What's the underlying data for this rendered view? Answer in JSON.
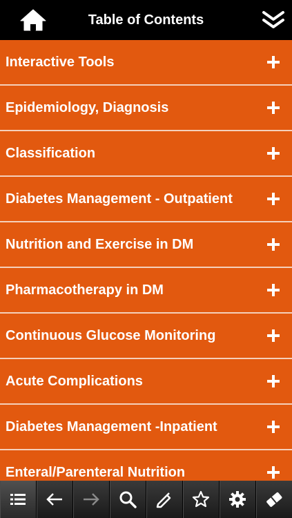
{
  "header": {
    "title": "Table of Contents"
  },
  "colors": {
    "row_background": "#e2590f",
    "row_divider": "#f5d0bb",
    "header_background": "#000000",
    "toolbar_background": "#2a2a2a"
  },
  "toc": {
    "items": [
      {
        "label": "Interactive Tools"
      },
      {
        "label": "Epidemiology, Diagnosis"
      },
      {
        "label": "Classification"
      },
      {
        "label": "Diabetes Management - Outpatient"
      },
      {
        "label": "Nutrition and Exercise in DM"
      },
      {
        "label": "Pharmacotherapy in DM"
      },
      {
        "label": "Continuous Glucose Monitoring"
      },
      {
        "label": "Acute Complications"
      },
      {
        "label": "Diabetes Management -Inpatient"
      },
      {
        "label": "Enteral/Parenteral Nutrition"
      }
    ],
    "expand_icon": "plus-icon"
  },
  "toolbar": {
    "buttons": [
      {
        "icon": "list-icon",
        "active": true
      },
      {
        "icon": "back-arrow-icon",
        "enabled": true
      },
      {
        "icon": "forward-arrow-icon",
        "enabled": false
      },
      {
        "icon": "search-icon",
        "enabled": true
      },
      {
        "icon": "highlighter-icon",
        "enabled": true
      },
      {
        "icon": "star-icon",
        "enabled": true
      },
      {
        "icon": "gear-icon",
        "enabled": true
      },
      {
        "icon": "eraser-icon",
        "enabled": true
      }
    ]
  }
}
